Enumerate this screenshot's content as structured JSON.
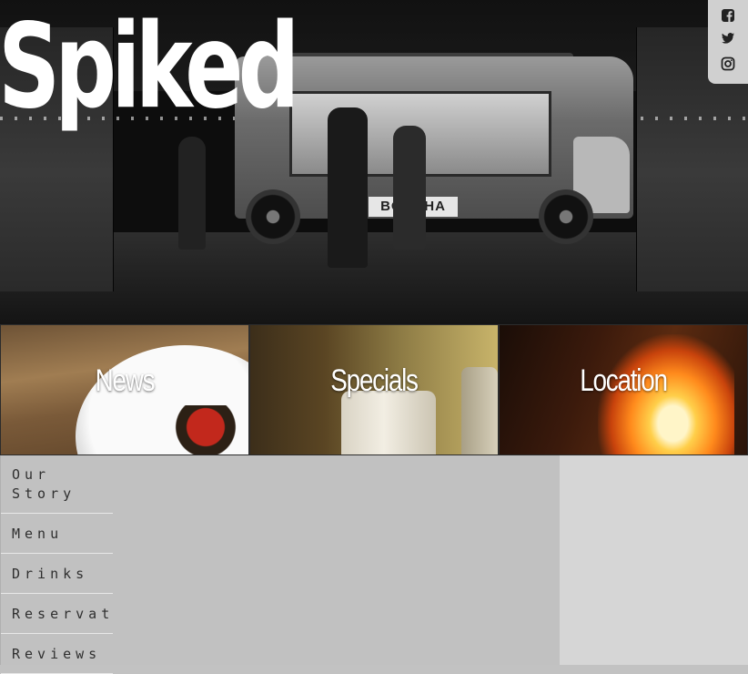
{
  "header": {
    "brand": "Spiked",
    "truck_sign": "BOBCHA"
  },
  "social": {
    "items": [
      {
        "name": "facebook-icon"
      },
      {
        "name": "twitter-icon"
      },
      {
        "name": "instagram-icon"
      }
    ],
    "bg_color": "#d0d0d0"
  },
  "tiles": [
    {
      "label": "News"
    },
    {
      "label": "Specials"
    },
    {
      "label": "Location"
    }
  ],
  "nav": {
    "items": [
      {
        "label": "Our Story"
      },
      {
        "label": "Menu"
      },
      {
        "label": "Drinks"
      },
      {
        "label": "Reservations"
      },
      {
        "label": "Reviews"
      }
    ]
  },
  "colors": {
    "content_bg": "#c1c1c1",
    "sidebar_bg": "#d6d6d6",
    "nav_text": "#2f2f2f"
  }
}
